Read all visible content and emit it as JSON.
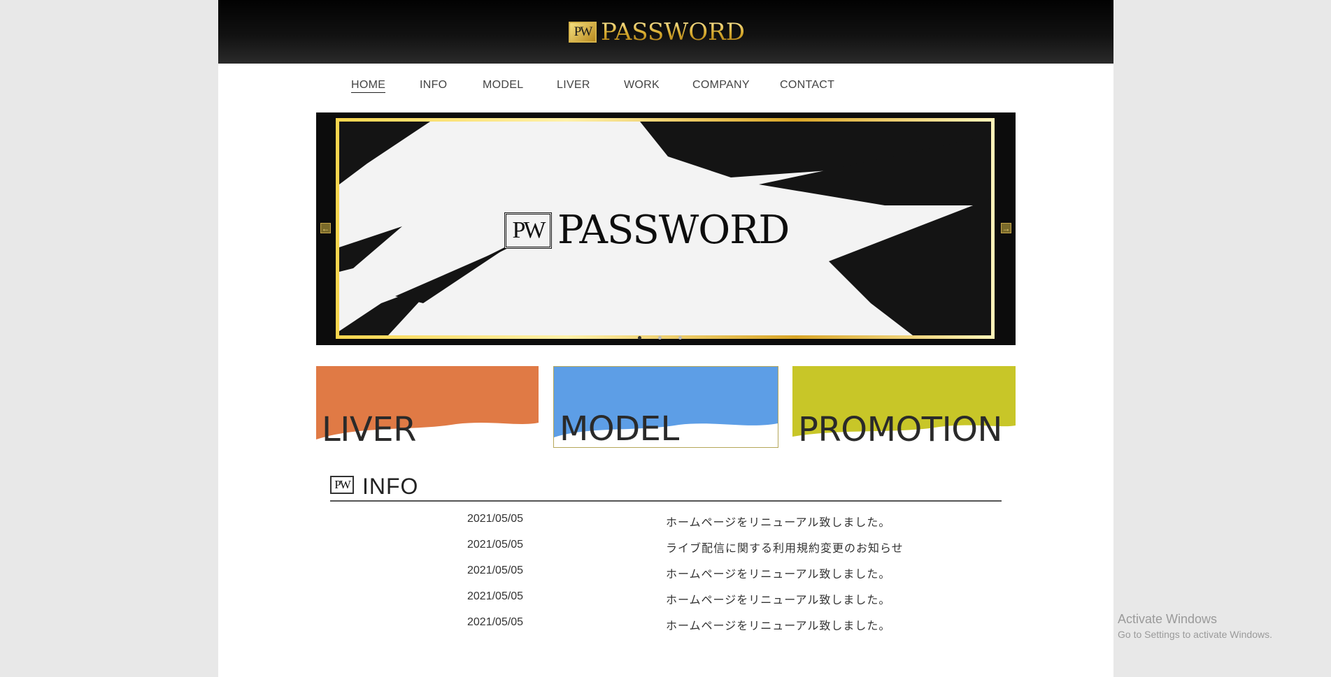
{
  "header": {
    "logo_mark": "PW",
    "logo_text": "PASSWORD"
  },
  "nav": [
    {
      "label": "HOME",
      "active": true
    },
    {
      "label": "INFO"
    },
    {
      "label": "MODEL"
    },
    {
      "label": "LIVER"
    },
    {
      "label": "WORK"
    },
    {
      "label": "COMPANY"
    },
    {
      "label": "CONTACT"
    }
  ],
  "slider": {
    "logo_mark": "PW",
    "logo_text": "PASSWORD",
    "prev_icon": "arrow-left-icon",
    "next_icon": "arrow-right-icon",
    "slide_count": 3,
    "current_slide": 1
  },
  "categories": [
    {
      "label": "LIVER",
      "color": "#e07a45"
    },
    {
      "label": "MODEL",
      "color": "#5d9ee6"
    },
    {
      "label": "PROMOTION",
      "color": "#c8c628"
    }
  ],
  "info": {
    "mark": "PW",
    "heading": "INFO",
    "items": [
      {
        "date": "2021/05/05",
        "text": "ホームページをリニューアル致しました。"
      },
      {
        "date": "2021/05/05",
        "text": "ライブ配信に関する利用規約変更のお知らせ"
      },
      {
        "date": "2021/05/05",
        "text": "ホームページをリニューアル致しました。"
      },
      {
        "date": "2021/05/05",
        "text": "ホームページをリニューアル致しました。"
      },
      {
        "date": "2021/05/05",
        "text": "ホームページをリニューアル致しました。"
      }
    ]
  },
  "watermark": {
    "line1": "Activate Windows",
    "line2": "Go to Settings to activate Windows."
  }
}
